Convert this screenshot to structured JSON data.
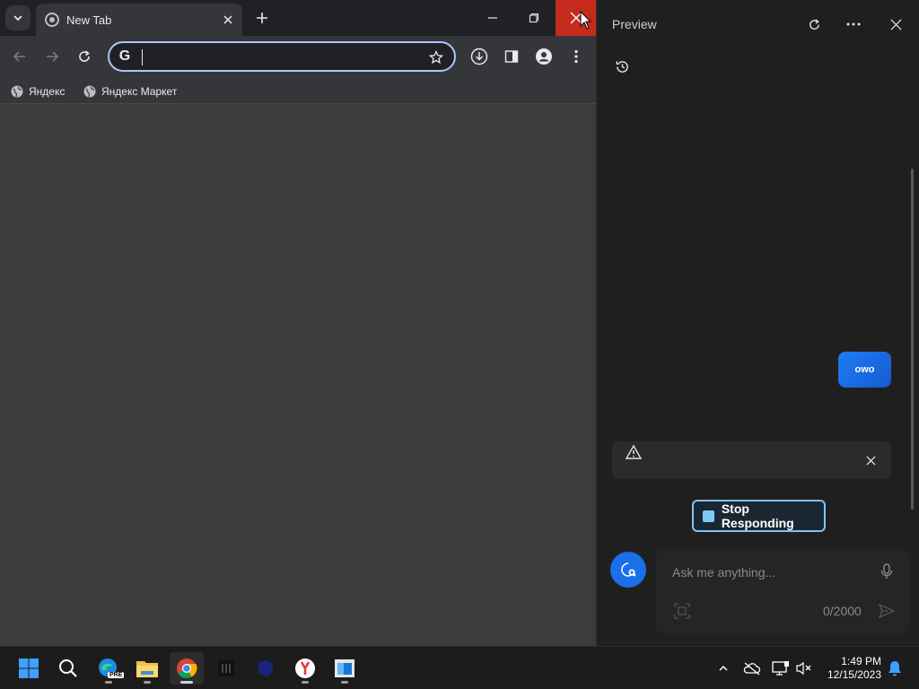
{
  "browser": {
    "tab_title": "New Tab",
    "omnibox_value": "",
    "bookmarks": [
      {
        "label": "Яндекс"
      },
      {
        "label": "Яндекс Маркет"
      }
    ]
  },
  "panel": {
    "title": "Preview",
    "message": "owo",
    "warning_text": "",
    "stop_label": "Stop Responding",
    "input_placeholder": "Ask me anything...",
    "counter": "0/2000"
  },
  "taskbar": {
    "time": "1:49 PM",
    "date": "12/15/2023",
    "edge_badge": "PRE"
  },
  "colors": {
    "accent_blue": "#1b6fe8",
    "close_red": "#c42b1c",
    "omnibox_border": "#a8c7fa"
  }
}
